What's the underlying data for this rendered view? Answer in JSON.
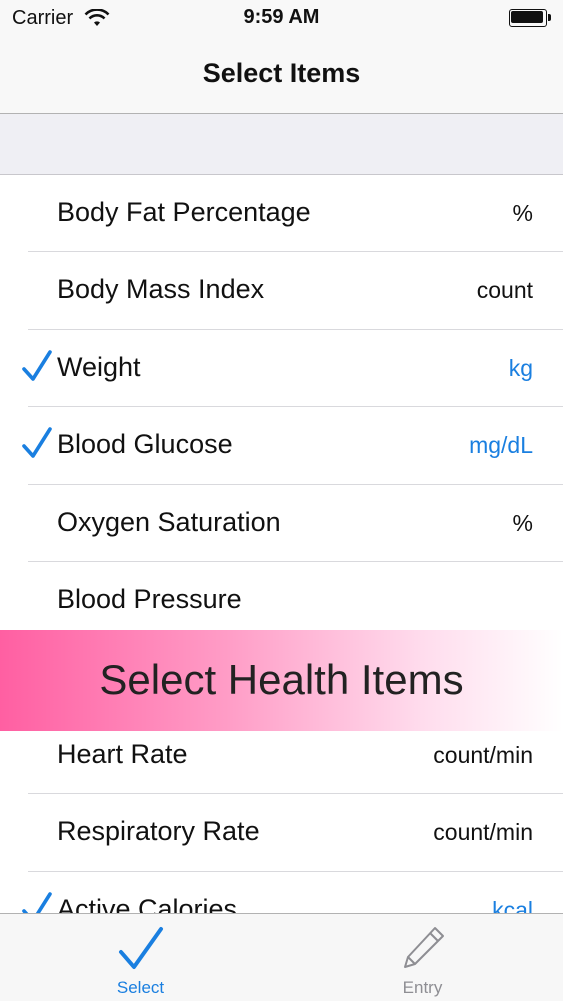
{
  "status_bar": {
    "carrier": "Carrier",
    "time": "9:59 AM"
  },
  "nav": {
    "title": "Select Items"
  },
  "items": [
    {
      "label": "Body Fat Percentage",
      "unit": "%",
      "selected": false
    },
    {
      "label": "Body Mass Index",
      "unit": "count",
      "selected": false
    },
    {
      "label": "Weight",
      "unit": "kg",
      "selected": true
    },
    {
      "label": "Blood Glucose",
      "unit": "mg/dL",
      "selected": true
    },
    {
      "label": "Oxygen Saturation",
      "unit": "%",
      "selected": false
    },
    {
      "label": "Blood Pressure",
      "unit": "",
      "selected": false
    },
    {
      "label": "",
      "unit": "",
      "selected": false
    },
    {
      "label": "Heart Rate",
      "unit": "count/min",
      "selected": false
    },
    {
      "label": "Respiratory Rate",
      "unit": "count/min",
      "selected": false
    },
    {
      "label": "Active Calories",
      "unit": "kcal",
      "selected": true
    }
  ],
  "banner": {
    "text": "Select Health Items"
  },
  "tabs": [
    {
      "label": "Select",
      "icon": "checkmark-icon",
      "active": true
    },
    {
      "label": "Entry",
      "icon": "pencil-icon",
      "active": false
    }
  ],
  "colors": {
    "accent": "#1a7fe0",
    "banner_start": "#ff5fa2",
    "banner_end": "#ffffff"
  }
}
